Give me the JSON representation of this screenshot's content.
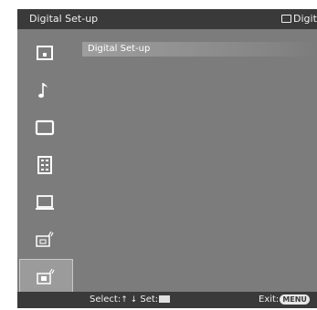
{
  "header": {
    "title": "Digital Set-up",
    "right_text": "Digit",
    "right_icon": "screen-outline-icon"
  },
  "sidebar": {
    "items": [
      {
        "icon": "picture-settings-icon"
      },
      {
        "icon": "music-note-icon"
      },
      {
        "icon": "screen-icon"
      },
      {
        "icon": "features-list-icon"
      },
      {
        "icon": "monitor-setup-icon"
      },
      {
        "icon": "analog-setup-icon"
      },
      {
        "icon": "digital-setup-icon",
        "selected": true
      }
    ]
  },
  "main": {
    "section_title": "Digital Set-up"
  },
  "footer": {
    "select_label": "Select:",
    "select_arrows": "↑ ↓",
    "set_label": "Set:",
    "set_icon": "enter-icon",
    "exit_label": "Exit:",
    "menu_label": "MENU"
  },
  "colors": {
    "panel": "#7c7c7c",
    "bars": "#3a3a3a",
    "text": "#f0f0f0",
    "selected_bg": "#9b9b9b"
  }
}
